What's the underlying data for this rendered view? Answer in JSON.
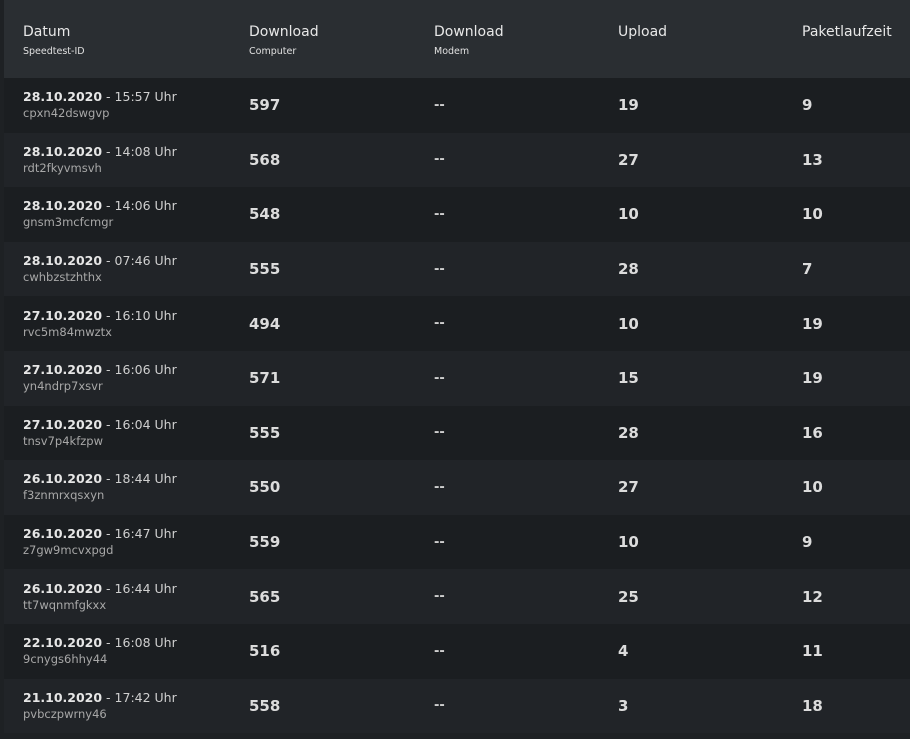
{
  "header": {
    "col_date": "Datum",
    "col_date_sub": "Speedtest-ID",
    "col_download_computer": "Download",
    "col_download_computer_sub": "Computer",
    "col_download_modem": "Download",
    "col_download_modem_sub": "Modem",
    "col_upload": "Upload",
    "col_ping": "Paketlaufzeit"
  },
  "rows": [
    {
      "date": "28.10.2020",
      "time": " - 15:57 Uhr",
      "id": "cpxn42dswgvp",
      "download": "597",
      "modem": "--",
      "upload": "19",
      "ping": "9"
    },
    {
      "date": "28.10.2020",
      "time": " - 14:08 Uhr",
      "id": "rdt2fkyvmsvh",
      "download": "568",
      "modem": "--",
      "upload": "27",
      "ping": "13"
    },
    {
      "date": "28.10.2020",
      "time": " - 14:06 Uhr",
      "id": "gnsm3mcfcmgr",
      "download": "548",
      "modem": "--",
      "upload": "10",
      "ping": "10"
    },
    {
      "date": "28.10.2020",
      "time": " - 07:46 Uhr",
      "id": "cwhbzstzhthx",
      "download": "555",
      "modem": "--",
      "upload": "28",
      "ping": "7"
    },
    {
      "date": "27.10.2020",
      "time": " - 16:10 Uhr",
      "id": "rvc5m84mwztx",
      "download": "494",
      "modem": "--",
      "upload": "10",
      "ping": "19"
    },
    {
      "date": "27.10.2020",
      "time": " - 16:06 Uhr",
      "id": "yn4ndrp7xsvr",
      "download": "571",
      "modem": "--",
      "upload": "15",
      "ping": "19"
    },
    {
      "date": "27.10.2020",
      "time": " - 16:04 Uhr",
      "id": "tnsv7p4kfzpw",
      "download": "555",
      "modem": "--",
      "upload": "28",
      "ping": "16"
    },
    {
      "date": "26.10.2020",
      "time": " - 18:44 Uhr",
      "id": "f3znmrxqsxyn",
      "download": "550",
      "modem": "--",
      "upload": "27",
      "ping": "10"
    },
    {
      "date": "26.10.2020",
      "time": " - 16:47 Uhr",
      "id": "z7gw9mcvxpgd",
      "download": "559",
      "modem": "--",
      "upload": "10",
      "ping": "9"
    },
    {
      "date": "26.10.2020",
      "time": " - 16:44 Uhr",
      "id": "tt7wqnmfgkxx",
      "download": "565",
      "modem": "--",
      "upload": "25",
      "ping": "12"
    },
    {
      "date": "22.10.2020",
      "time": " - 16:08 Uhr",
      "id": "9cnygs6hhy44",
      "download": "516",
      "modem": "--",
      "upload": "4",
      "ping": "11"
    },
    {
      "date": "21.10.2020",
      "time": " - 17:42 Uhr",
      "id": "pvbczpwrny46",
      "download": "558",
      "modem": "--",
      "upload": "3",
      "ping": "18"
    }
  ]
}
